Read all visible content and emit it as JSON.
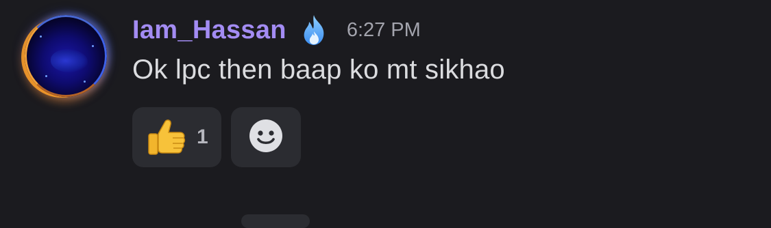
{
  "message": {
    "author": "Iam_Hassan",
    "author_badge_icon": "fire-icon",
    "timestamp": "6:27 PM",
    "content": "Ok lpc then baap ko mt sikhao",
    "avatar_icon": "user-avatar",
    "reactions": [
      {
        "emoji_icon": "thumbs-up-emoji",
        "count": "1"
      }
    ],
    "add_reaction_icon": "smiley-icon"
  },
  "colors": {
    "background": "#1b1b1f",
    "username": "#a38cf3",
    "text": "#dbdcdf",
    "timestamp": "#a3a4ad",
    "reaction_bg": "#2b2c31"
  }
}
